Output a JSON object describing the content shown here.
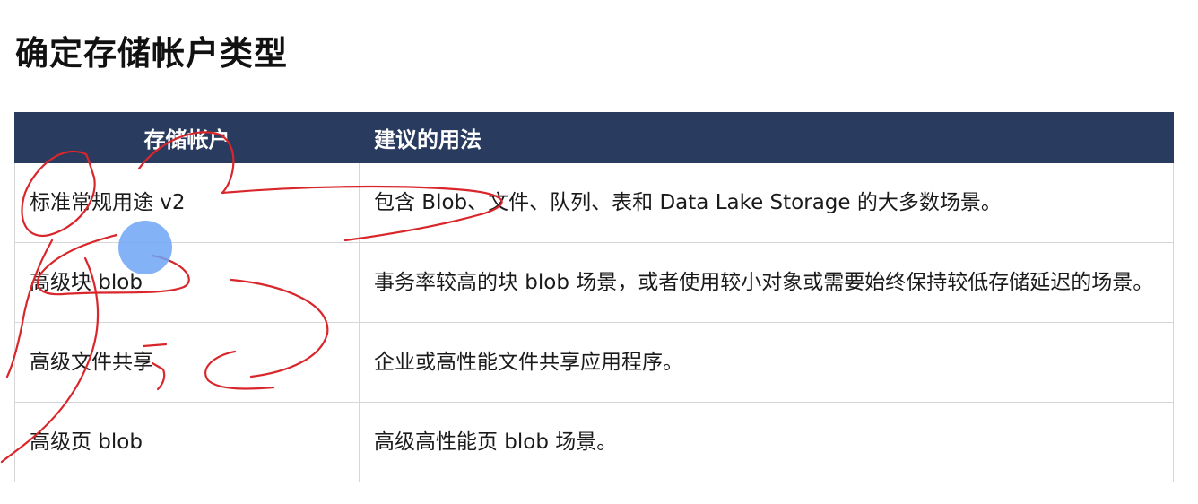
{
  "page": {
    "title": "确定存储帐户类型"
  },
  "table": {
    "headers": {
      "account": "存储帐户",
      "usage": "建议的用法"
    },
    "rows": [
      {
        "account": "标准常规用途 v2",
        "usage": "包含 Blob、文件、队列、表和 Data Lake Storage 的大多数场景。"
      },
      {
        "account": "高级块 blob",
        "usage": "事务率较高的块 blob 场景，或者使用较小对象或需要始终保持较低存储延迟的场景。"
      },
      {
        "account": "高级文件共享",
        "usage": "企业或高性能文件共享应用程序。"
      },
      {
        "account": "高级页 blob",
        "usage": "高级高性能页 blob 场景。"
      }
    ]
  },
  "colors": {
    "header_bg": "#2a3b60",
    "annotation_ink": "#d9262b",
    "cursor_highlight": "#6ea5f5"
  }
}
